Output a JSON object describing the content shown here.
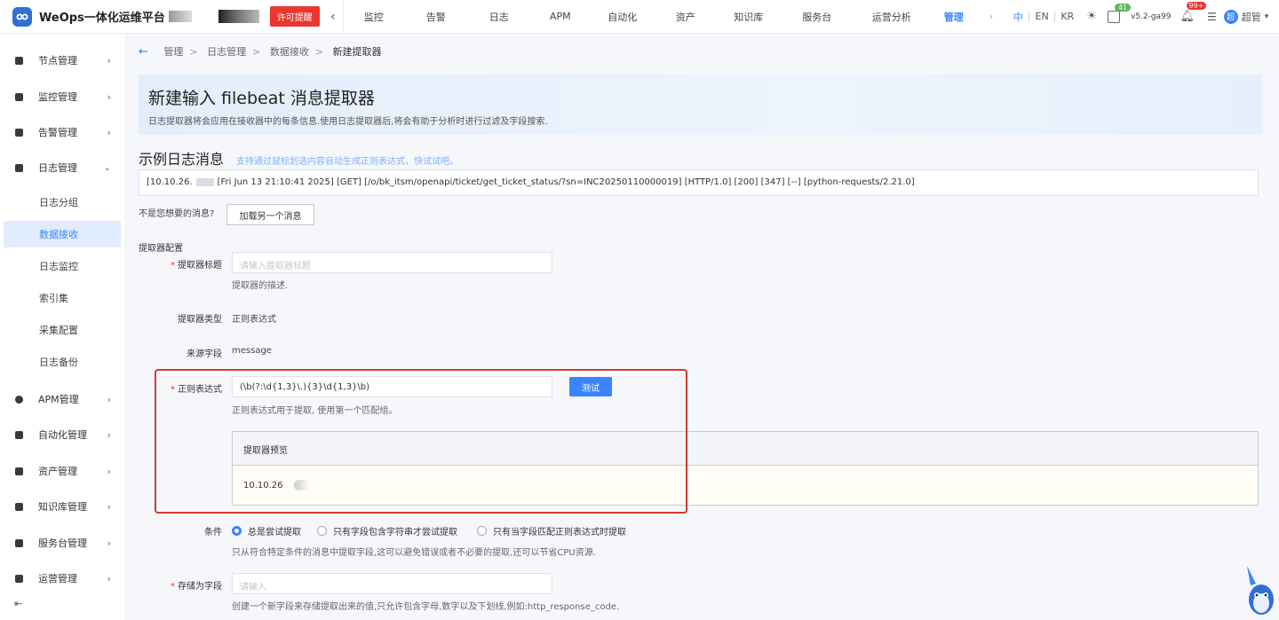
{
  "header": {
    "app_name": "WeOps一体化运维平台",
    "license_btn": "许可提醒",
    "nav": [
      {
        "label": "监控",
        "active": false
      },
      {
        "label": "告警",
        "active": false
      },
      {
        "label": "日志",
        "active": false
      },
      {
        "label": "APM",
        "active": false
      },
      {
        "label": "自动化",
        "active": false
      },
      {
        "label": "资产",
        "active": false
      },
      {
        "label": "知识库",
        "active": false
      },
      {
        "label": "服务台",
        "active": false
      },
      {
        "label": "运营分析",
        "active": false
      },
      {
        "label": "管理",
        "active": true
      }
    ],
    "lang_zh": "中",
    "lang_en": "EN",
    "lang_kr": "KR",
    "task_badge": "41",
    "version": "v5.2-ga99",
    "notify_badge": "99+",
    "user": "超管"
  },
  "sidebar": {
    "items": [
      {
        "label": "节点管理",
        "icon": "node-icon"
      },
      {
        "label": "监控管理",
        "icon": "monitor-icon"
      },
      {
        "label": "告警管理",
        "icon": "alarm-icon"
      },
      {
        "label": "日志管理",
        "icon": "log-icon"
      },
      {
        "label": "APM管理",
        "icon": "apm-icon"
      },
      {
        "label": "自动化管理",
        "icon": "automation-icon"
      },
      {
        "label": "资产管理",
        "icon": "asset-icon"
      },
      {
        "label": "知识库管理",
        "icon": "knowledge-icon"
      },
      {
        "label": "服务台管理",
        "icon": "service-desk-icon"
      },
      {
        "label": "运营管理",
        "icon": "operation-icon"
      }
    ],
    "log_subitems": [
      {
        "label": "日志分组",
        "active": false
      },
      {
        "label": "数据接收",
        "active": true
      },
      {
        "label": "日志监控",
        "active": false
      },
      {
        "label": "索引集",
        "active": false
      },
      {
        "label": "采集配置",
        "active": false
      },
      {
        "label": "日志备份",
        "active": false
      }
    ]
  },
  "breadcrumb": [
    "管理",
    "日志管理",
    "数据接收",
    "新建提取器"
  ],
  "banner": {
    "title": "新建输入 filebeat 消息提取器",
    "desc": "日志提取器将会应用在接收器中的每条信息.使用日志提取器后,将会有助于分析时进行过滤及字段搜索."
  },
  "sample": {
    "title": "示例日志消息",
    "hint": "支持通过鼠标划选内容自动生成正则表达式，快试试吧。",
    "prefix": "[10.10.26.",
    "message": "[Fri Jun 13 21:10:41 2025] [GET] [/o/bk_itsm/openapi/ticket/get_ticket_status/?sn=INC20250110000019] [HTTP/1.0] [200] [347] [--] [python-requests/2.21.0]",
    "not_wanted": "不是您想要的消息?",
    "load_another": "加载另一个消息"
  },
  "form": {
    "section_title": "提取器配置",
    "title_label": "提取器标题",
    "title_placeholder": "请输入提取器标题",
    "title_hint": "提取器的描述.",
    "type_label": "提取器类型",
    "type_value": "正则表达式",
    "source_label": "来源字段",
    "source_value": "message",
    "regex_label": "正则表达式",
    "regex_value": "(\\b(?:\\d{1,3}\\.){3}\\d{1,3}\\b)",
    "test_btn": "测试",
    "regex_hint": "正则表达式用于提取, 使用第一个匹配组。",
    "preview_title": "提取器预览",
    "preview_value": "10.10.26",
    "condition_label": "条件",
    "conditions": [
      "总是尝试提取",
      "只有字段包含字符串才尝试提取",
      "只有当字段匹配正则表达式时提取"
    ],
    "condition_selected": 0,
    "condition_hint": "只从符合特定条件的消息中提取字段,这可以避免错误或者不必要的提取,还可以节省CPU资源.",
    "store_label": "存储为字段",
    "store_placeholder": "请输入",
    "store_hint": "创建一个新字段来存储提取出来的值,只允许包含字母,数字以及下划线,例如:http_response_code."
  }
}
